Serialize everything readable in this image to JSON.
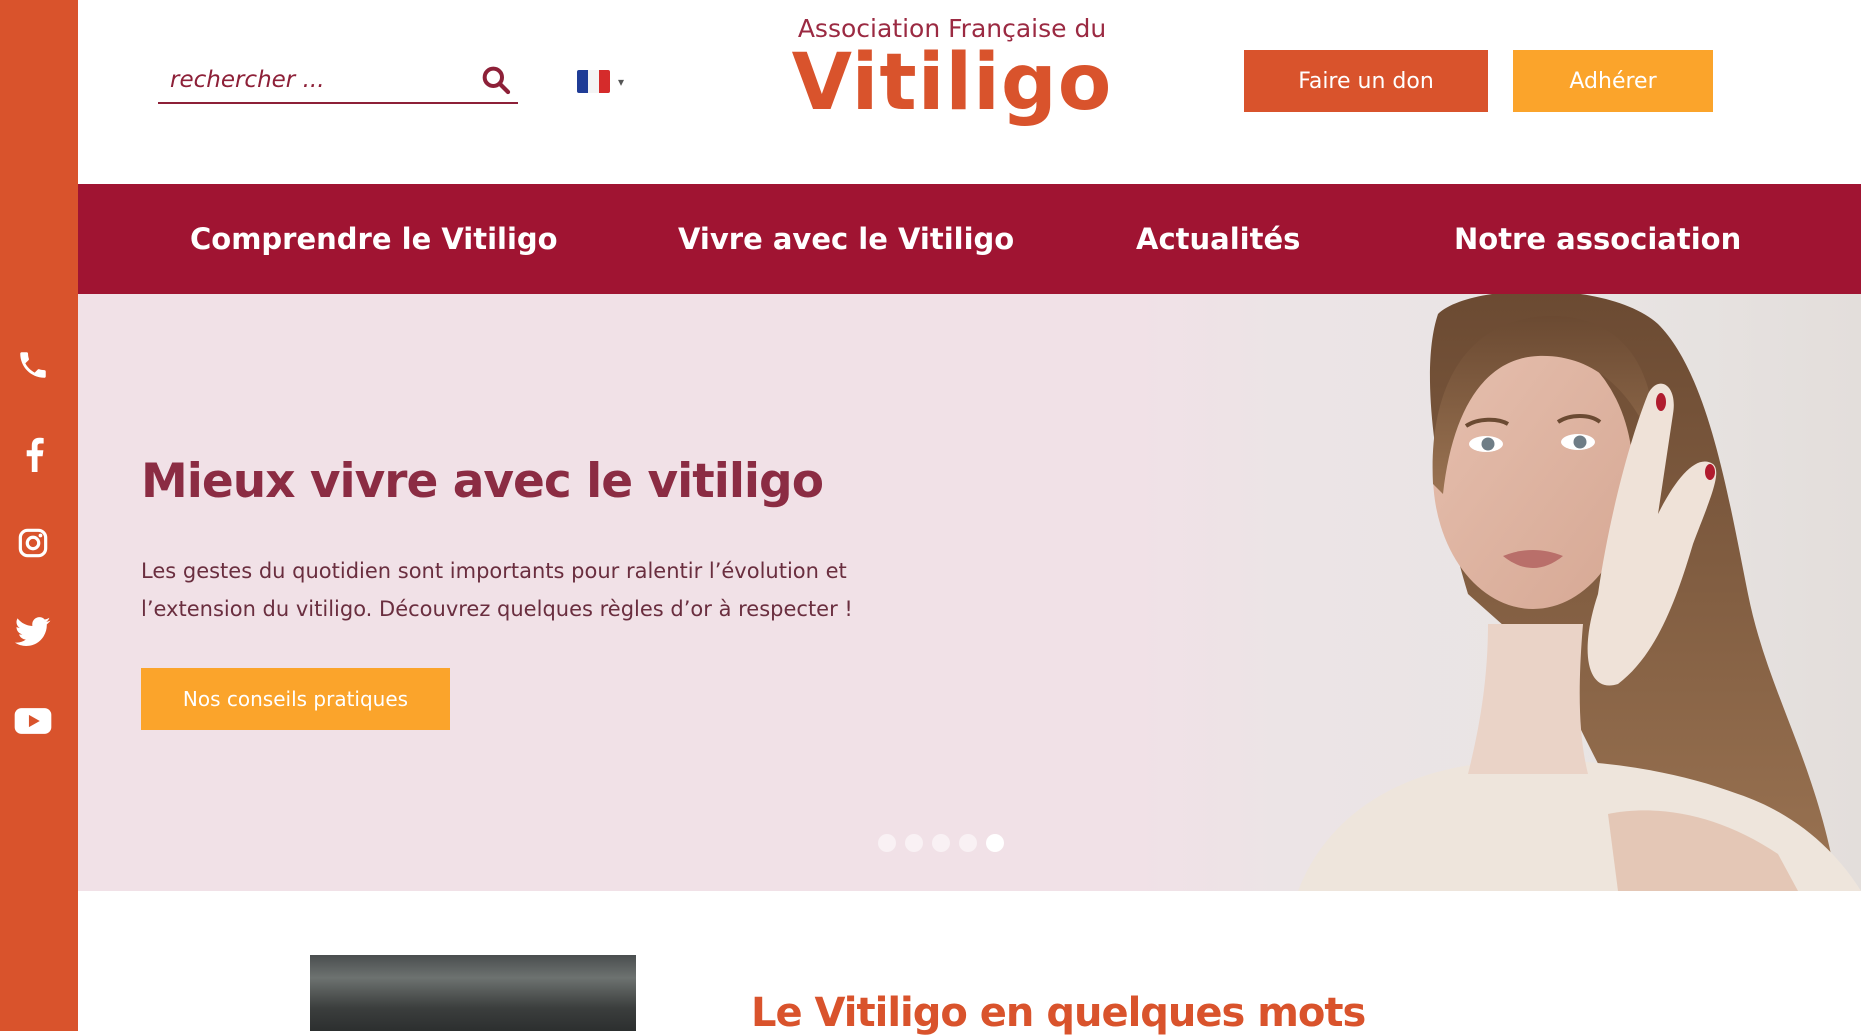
{
  "colors": {
    "sidebar": "#d9532c",
    "nav": "#a01432",
    "donate_button": "#d9532c",
    "join_button": "#fba42b",
    "hero_background": "#f1e1e7",
    "hero_title": "#8b2c43",
    "section_title": "#d9532c"
  },
  "social": {
    "icons": [
      "phone-icon",
      "facebook-icon",
      "instagram-icon",
      "twitter-icon",
      "youtube-icon"
    ]
  },
  "header": {
    "search_placeholder": "rechercher ...",
    "language_flag": "french-flag-icon",
    "language_caret": "▾",
    "logo_top": "Association Française du",
    "logo_main": "Vitiligo",
    "donate_label": "Faire un don",
    "join_label": "Adhérer"
  },
  "nav": {
    "items": [
      {
        "label": "Comprendre le Vitiligo"
      },
      {
        "label": "Vivre avec le Vitiligo"
      },
      {
        "label": "Actualités"
      },
      {
        "label": "Notre association"
      }
    ]
  },
  "hero": {
    "title": "Mieux vivre avec le vitiligo",
    "text": "Les gestes du quotidien sont importants pour ralentir l’évolution et l’extension du vitiligo. Découvrez quelques règles d’or à respecter !",
    "cta_label": "Nos conseils pratiques",
    "slides_total": 5,
    "active_slide": 5
  },
  "section": {
    "title": "Le Vitiligo en quelques mots"
  }
}
